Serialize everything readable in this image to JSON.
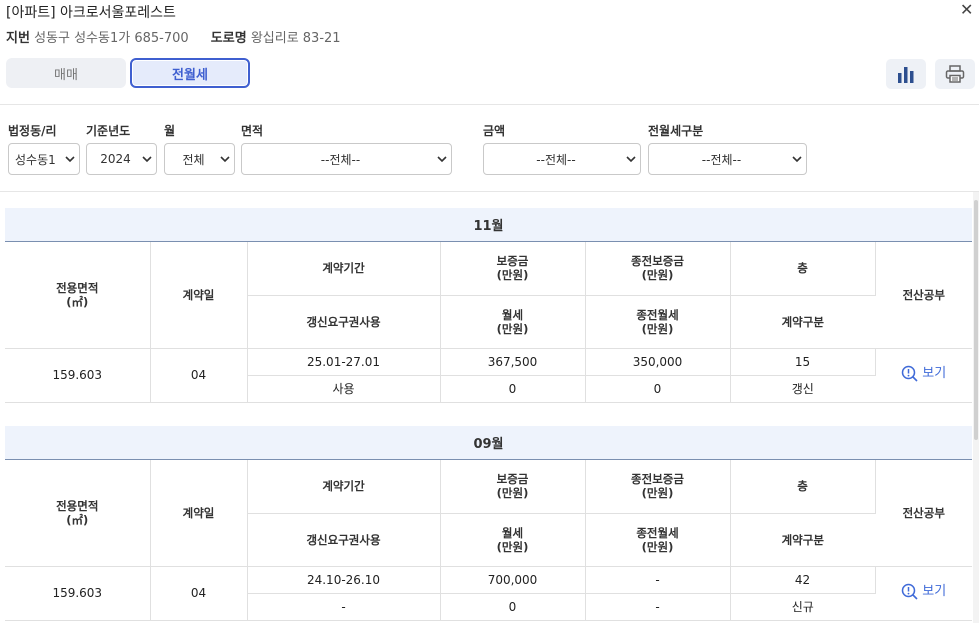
{
  "header": {
    "title": "[아파트] 아크로서울포레스트",
    "close": "✕",
    "jibun_label": "지번",
    "jibun_value": "성동구 성수동1가 685-700",
    "road_label": "도로명",
    "road_value": "왕십리로 83-21"
  },
  "tabs": [
    {
      "label": "매매",
      "active": false
    },
    {
      "label": "전월세",
      "active": true
    }
  ],
  "toolbar": {
    "chart_icon": "bar-chart-icon",
    "print_icon": "printer-icon"
  },
  "filters": {
    "dong": {
      "label": "법정동/리",
      "value": "성수동1"
    },
    "year": {
      "label": "기준년도",
      "value": "2024"
    },
    "month": {
      "label": "월",
      "value": "전체"
    },
    "area": {
      "label": "면적",
      "value": "--전체--"
    },
    "amount": {
      "label": "금액",
      "value": "--전체--"
    },
    "rent_type": {
      "label": "전월세구분",
      "value": "--전체--"
    }
  },
  "columns": {
    "area": "전용면적\n(㎡)",
    "contract_day": "계약일",
    "period": "계약기간",
    "deposit": "보증금\n(만원)",
    "prev_deposit": "종전보증금\n(만원)",
    "floor": "층",
    "registry": "전산공부",
    "renewal_right": "갱신요구권사용",
    "monthly": "월세\n(만원)",
    "prev_monthly": "종전월세\n(만원)",
    "contract_type": "계약구분"
  },
  "view_label": "보기",
  "months": [
    {
      "title": "11월",
      "records": [
        {
          "area": "159.603",
          "day": "04",
          "period": "25.01-27.01",
          "deposit": "367,500",
          "prev_deposit": "350,000",
          "floor": "15",
          "renewal": "사용",
          "monthly": "0",
          "prev_monthly": "0",
          "type": "갱신"
        }
      ]
    },
    {
      "title": "09월",
      "records": [
        {
          "area": "159.603",
          "day": "04",
          "period": "24.10-26.10",
          "deposit": "700,000",
          "prev_deposit": "-",
          "floor": "42",
          "renewal": "-",
          "monthly": "0",
          "prev_monthly": "-",
          "type": "신규"
        }
      ]
    }
  ]
}
